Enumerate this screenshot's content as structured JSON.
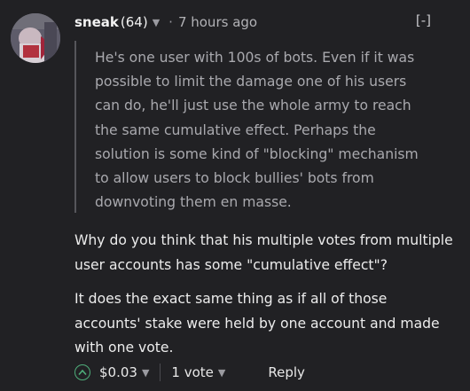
{
  "comment": {
    "author": "sneak",
    "reputation": "(64)",
    "separator": "·",
    "time": "7 hours ago",
    "collapse": "[-]",
    "quote": "He's one user with 100s of bots. Even if it was possible to limit the damage one of his users can do, he'll just use the whole army to reach the same cumulative effect. Perhaps the solution is some kind of \"blocking\" mechanism to allow users to block bullies' bots from downvoting them en masse.",
    "paragraphs": [
      "Why do you think that his multiple votes from multiple user accounts has some \"cumulative effect\"?",
      "It does the exact same thing as if all of those accounts' stake were held by one account and made with one vote."
    ]
  },
  "footer": {
    "payout": "$0.03",
    "votes": "1 vote",
    "reply": "Reply"
  },
  "colors": {
    "background": "#212124",
    "upvote_accent": "#4fae7a"
  },
  "icons": {
    "upvote": "chevron-up-circle-icon",
    "dropdown": "caret-down-icon",
    "avatar": "user-avatar"
  }
}
